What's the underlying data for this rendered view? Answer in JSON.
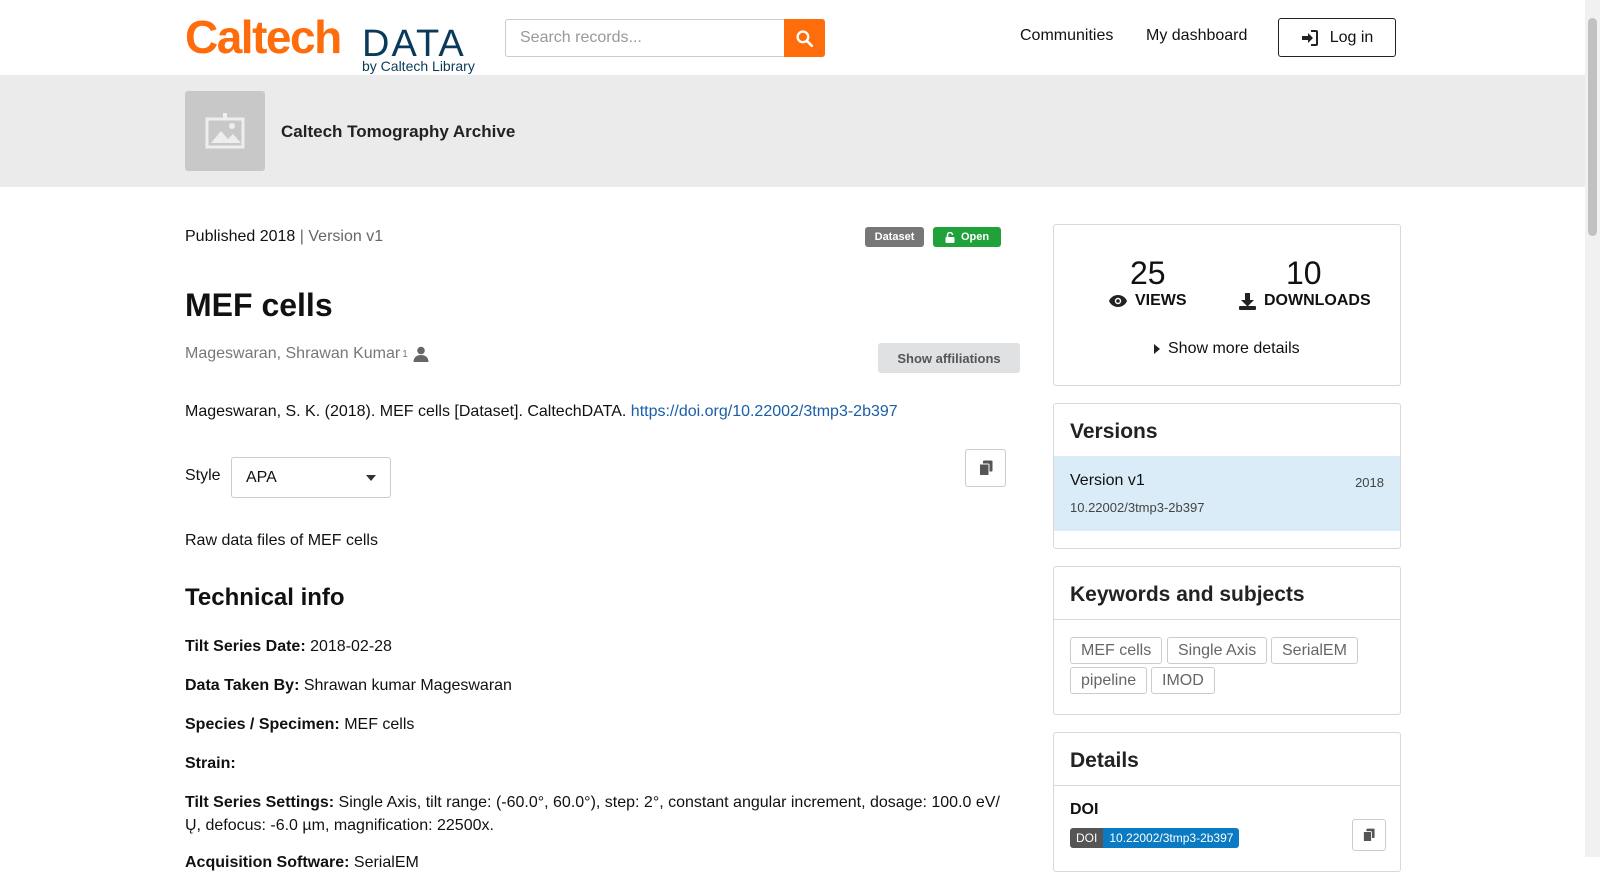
{
  "header": {
    "logo_caltech": "Caltech",
    "logo_data": "DATA",
    "logo_by": "by Caltech Library",
    "search_placeholder": "Search records...",
    "nav": [
      "Communities",
      "My dashboard"
    ],
    "login_label": "Log in"
  },
  "community": {
    "title": "Caltech Tomography Archive"
  },
  "record": {
    "published": "Published 2018",
    "separator": "|",
    "version": "Version v1",
    "badge_type": "Dataset",
    "badge_access": "Open",
    "title": "MEF cells",
    "creator": "Mageswaran, Shrawan Kumar",
    "creator_affiliation_mark": "1",
    "show_affiliations": "Show affiliations",
    "citation_text": "Mageswaran, S. K. (2018). MEF cells [Dataset]. CaltechDATA.",
    "citation_link": "https://doi.org/10.22002/3tmp3-2b397",
    "style_label": "Style",
    "style_value": "APA",
    "description": "Raw data files of MEF cells",
    "technical_heading": "Technical info",
    "fields": [
      {
        "label": "Tilt Series Date:",
        "value": "2018-02-28"
      },
      {
        "label": "Data Taken By:",
        "value": "Shrawan kumar Mageswaran"
      },
      {
        "label": "Species / Specimen:",
        "value": "MEF cells"
      },
      {
        "label": "Strain:",
        "value": ""
      },
      {
        "label": "Tilt Series Settings:",
        "value": "Single Axis, tilt range: (-60.0°, 60.0°), step: 2°, constant angular increment, dosage: 100.0 eV/Ų, defocus: -6.0 µm, magnification: 22500x."
      },
      {
        "label": "Acquisition Software:",
        "value": "SerialEM"
      }
    ]
  },
  "stats": {
    "views": "25",
    "views_label": "VIEWS",
    "downloads": "10",
    "downloads_label": "DOWNLOADS",
    "more_details": "Show more details"
  },
  "versions": {
    "heading": "Versions",
    "items": [
      {
        "label": "Version v1",
        "year": "2018",
        "doi": "10.22002/3tmp3-2b397"
      }
    ]
  },
  "keywords": {
    "heading": "Keywords and subjects",
    "items": [
      "MEF cells",
      "Single Axis",
      "SerialEM",
      "pipeline",
      "IMOD"
    ]
  },
  "details": {
    "heading": "Details",
    "doi_label": "DOI",
    "doi_badge_left": "DOI",
    "doi_badge_right": "10.22002/3tmp3-2b397"
  },
  "colors": {
    "brand_orange": "#ff6c0c",
    "open_green": "#21a13a",
    "link_blue": "#1a5ea8",
    "version_highlight": "#d9ecf7"
  }
}
